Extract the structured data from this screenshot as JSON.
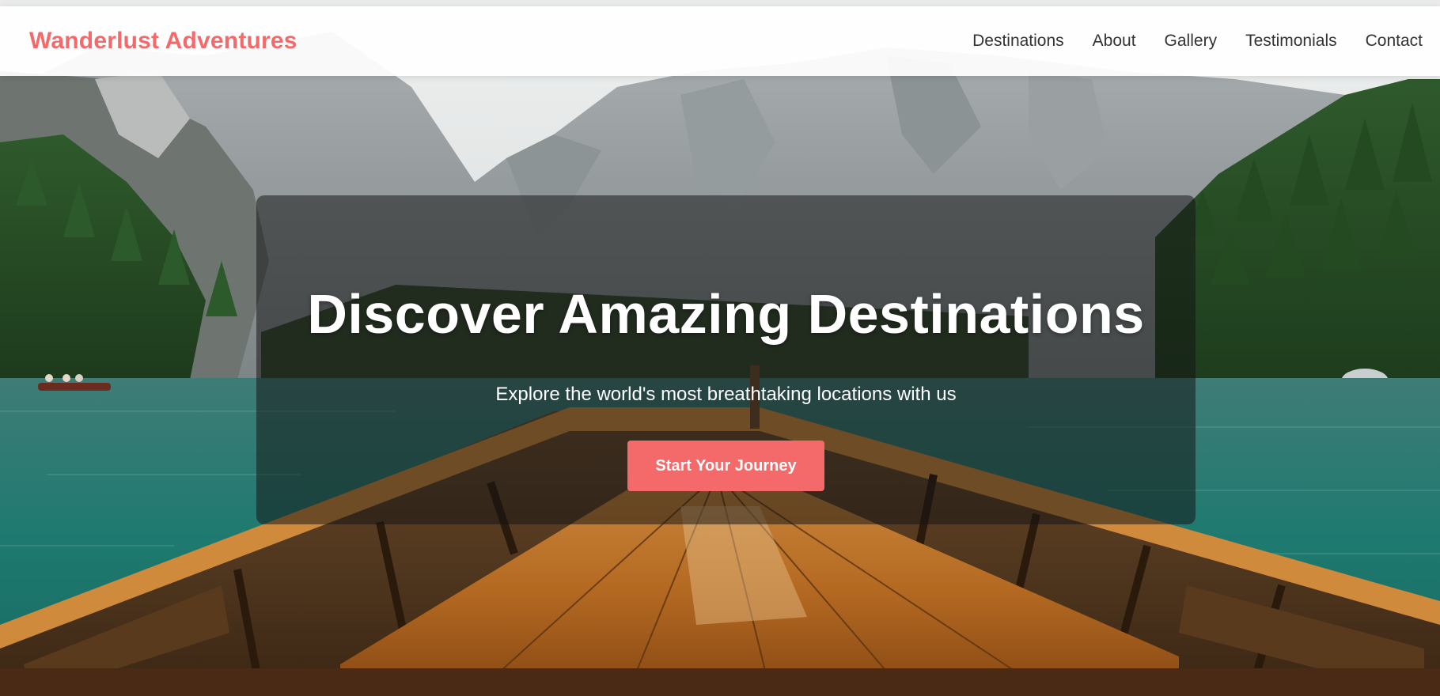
{
  "header": {
    "logo": "Wanderlust Adventures",
    "nav": [
      {
        "label": "Destinations"
      },
      {
        "label": "About"
      },
      {
        "label": "Gallery"
      },
      {
        "label": "Testimonials"
      },
      {
        "label": "Contact"
      }
    ]
  },
  "hero": {
    "title": "Discover Amazing Destinations",
    "subtitle": "Explore the world's most breathtaking locations with us",
    "cta_label": "Start Your Journey"
  },
  "colors": {
    "accent": "#f46a6a",
    "header_bg": "#ffffff",
    "overlay": "#141414"
  },
  "background": {
    "description_icon": "mountain-lake-boat-photo"
  }
}
